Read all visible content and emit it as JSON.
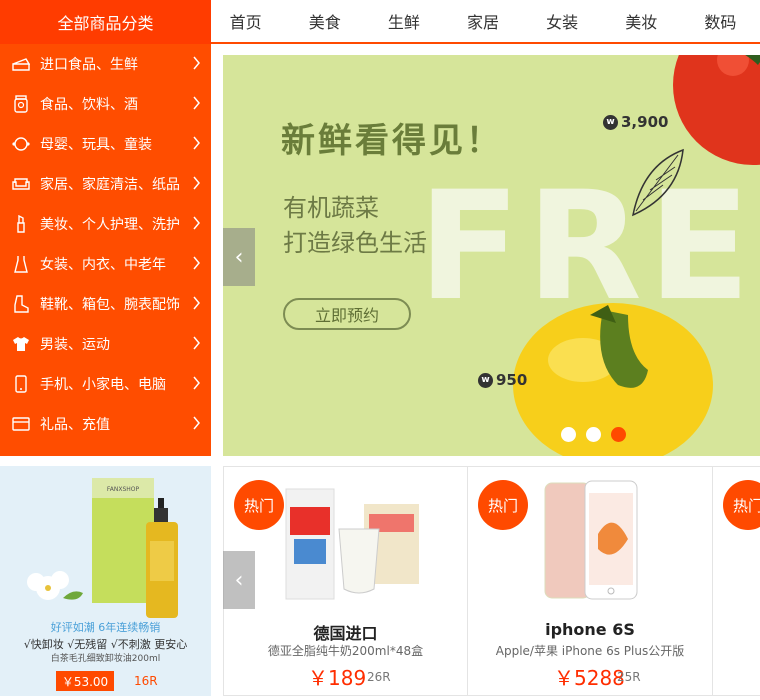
{
  "header": {
    "category_title": "全部商品分类",
    "nav": [
      "首页",
      "美食",
      "生鲜",
      "家居",
      "女装",
      "美妆",
      "数码"
    ]
  },
  "categories": [
    {
      "label": "进口食品、生鲜",
      "icon": "cake-icon"
    },
    {
      "label": "食品、饮料、酒",
      "icon": "jar-icon"
    },
    {
      "label": "母婴、玩具、童装",
      "icon": "baby-icon"
    },
    {
      "label": "家居、家庭清洁、纸品",
      "icon": "sofa-icon"
    },
    {
      "label": "美妆、个人护理、洗护",
      "icon": "lipstick-icon"
    },
    {
      "label": "女装、内衣、中老年",
      "icon": "dress-icon"
    },
    {
      "label": "鞋靴、箱包、腕表配饰",
      "icon": "boot-icon"
    },
    {
      "label": "男装、运动",
      "icon": "shirt-icon"
    },
    {
      "label": "手机、小家电、电脑",
      "icon": "phone-icon"
    },
    {
      "label": "礼品、充值",
      "icon": "card-icon"
    }
  ],
  "banner": {
    "title": "新鲜看得见！",
    "subtitle1": "有机蔬菜",
    "subtitle2": "打造绿色生活",
    "cta": "立即预约",
    "bg_text": "FRES",
    "price1": "3,900",
    "price2": "950",
    "currency_symbol": "w",
    "slides": 3,
    "active_slide": 3
  },
  "ad": {
    "brand": "FANXSHOP",
    "tagline": "好评如潮 6年连续畅销",
    "features": "√快卸妆 √无残留 √不刺激 更安心",
    "desc": "白茶毛孔细致卸妆油200ml",
    "price": "￥53.00",
    "old_price": "16R"
  },
  "products": [
    {
      "badge": "热门",
      "name": "德国进口",
      "desc": "德亚全脂纯牛奶200ml*48盒",
      "price": "￥189",
      "old": "26R"
    },
    {
      "badge": "热门",
      "name": "iphone 6S",
      "desc": "Apple/苹果 iPhone 6s Plus公开版",
      "price": "￥5288",
      "old": "25R"
    },
    {
      "badge": "热门"
    }
  ],
  "colors": {
    "accent": "#ff4a00",
    "banner_bg": "#d6e59a",
    "ad_bg": "#e3f0f8"
  }
}
